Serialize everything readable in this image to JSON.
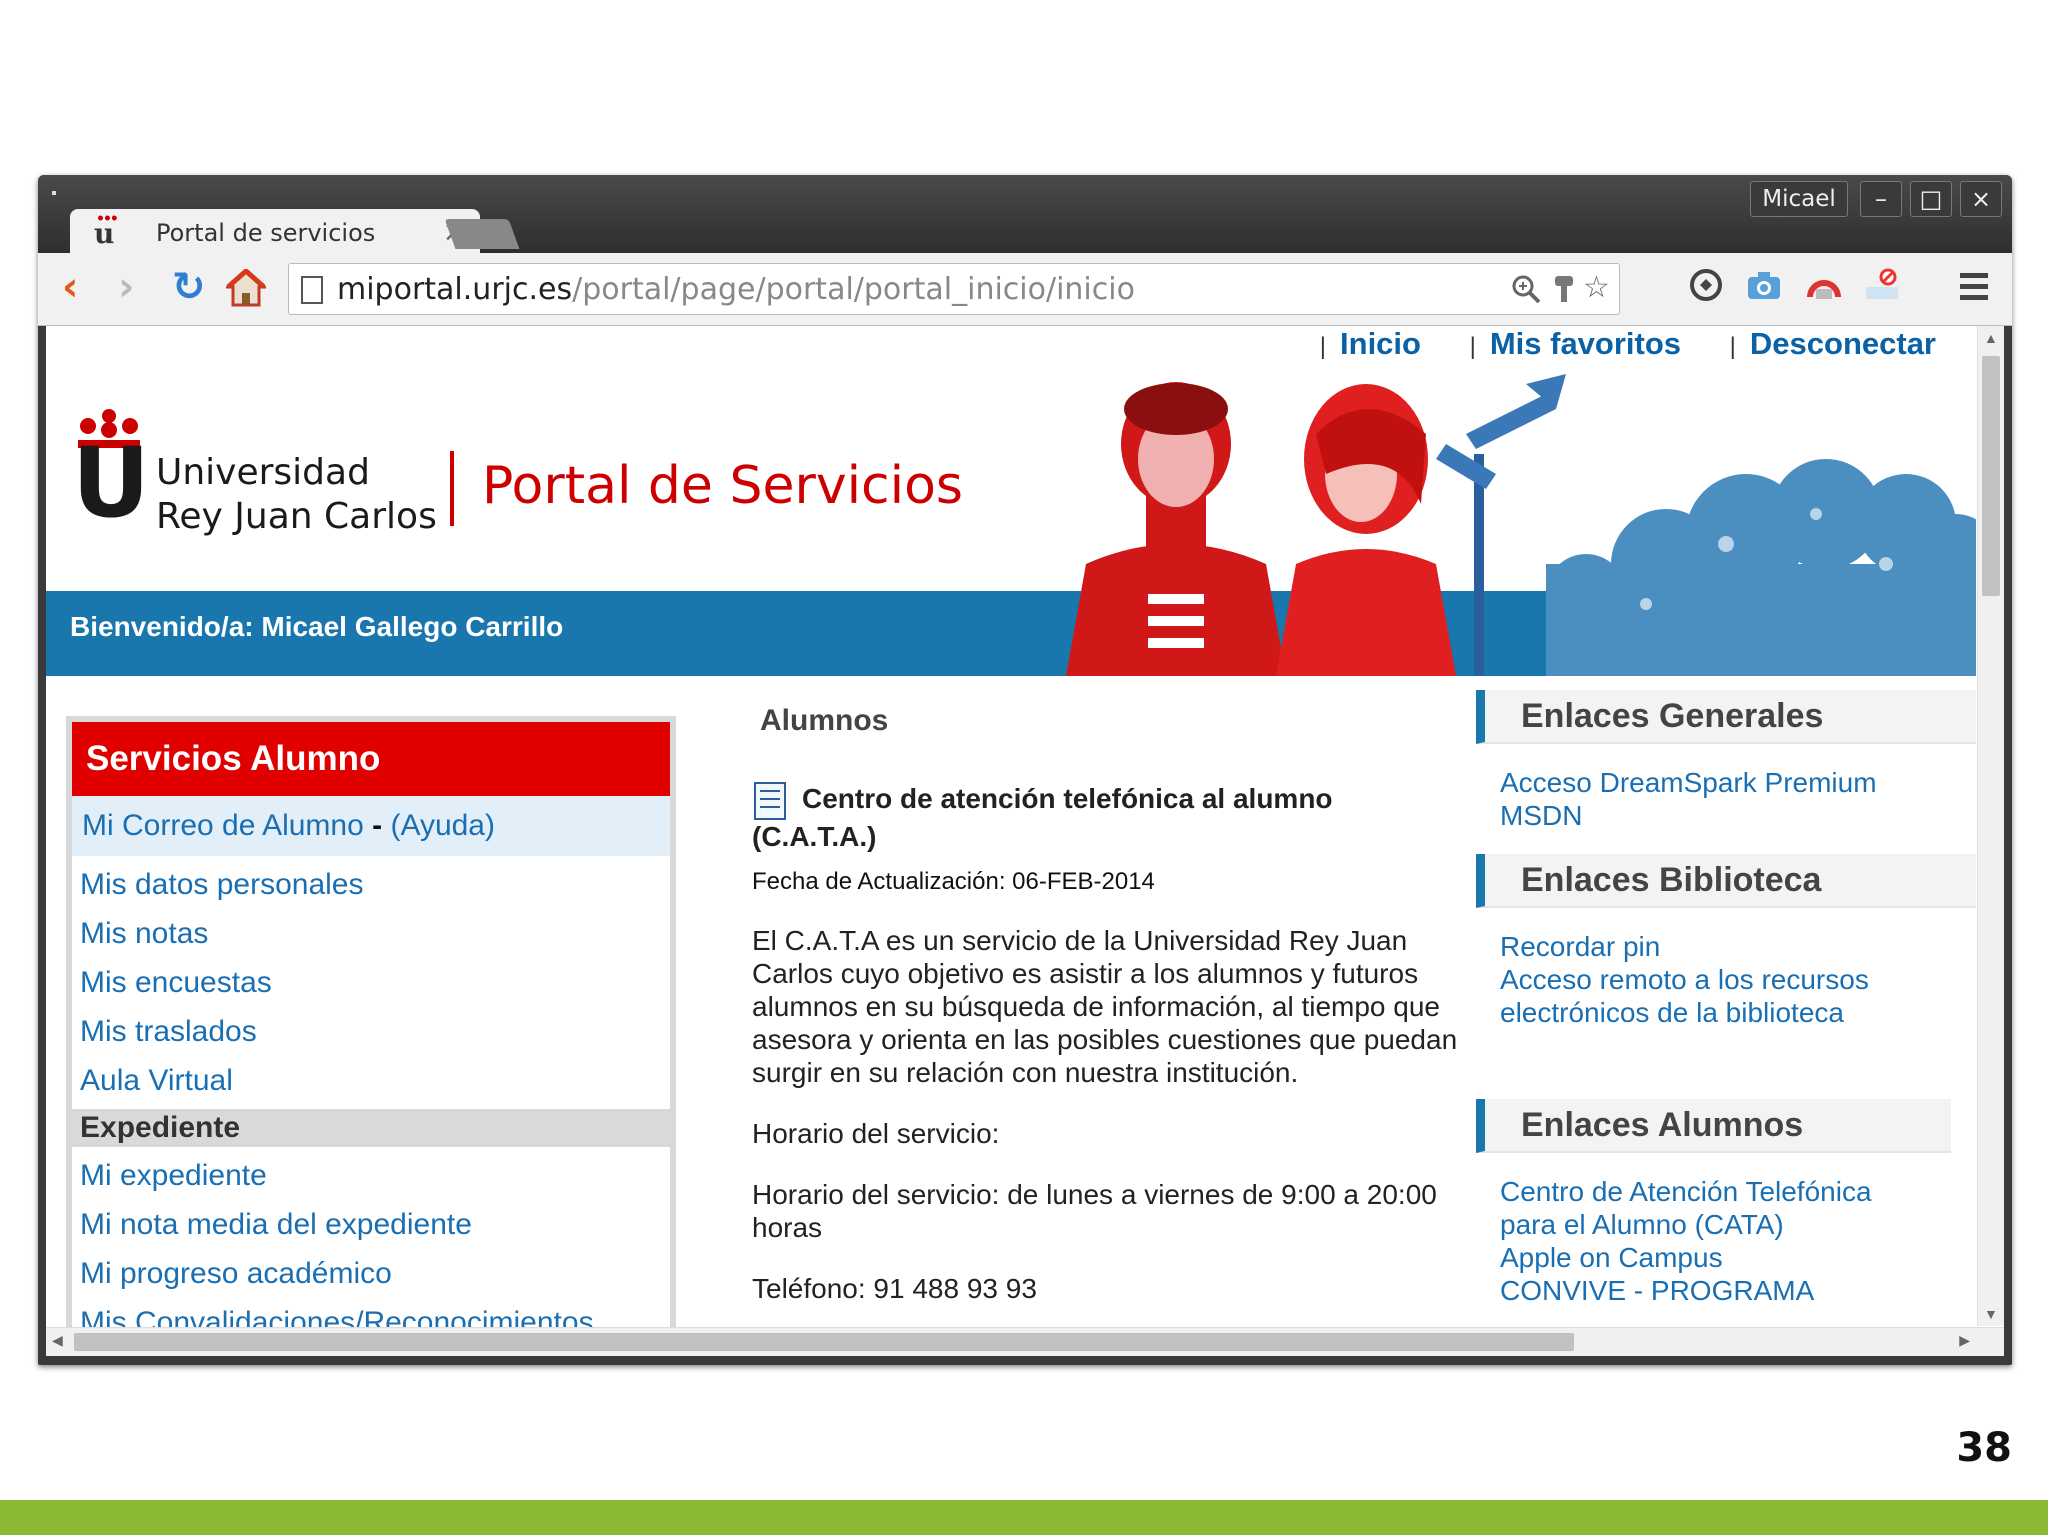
{
  "browser": {
    "tab_title": "Portal de servicios",
    "tab_close": "×",
    "user_name": "Micael",
    "window_buttons": {
      "minimize": "–",
      "maximize": "□",
      "close": "×"
    },
    "url_host": "miportal.urjc.es",
    "url_path": "/portal/page/portal/portal_inicio/inicio",
    "nav": {
      "back": "‹",
      "forward": "›",
      "reload": "↻"
    },
    "omnibox_icons": [
      "zoom-icon",
      "key-icon",
      "star-icon"
    ],
    "extension_icons": [
      "extension-1-icon",
      "camera-icon",
      "extension-3-icon",
      "extension-4-icon",
      "menu-icon"
    ]
  },
  "header": {
    "top_links": [
      {
        "sep": "|",
        "label": "Inicio"
      },
      {
        "sep": "|",
        "label": "Mis favoritos"
      },
      {
        "sep": "|",
        "label": "Desconectar"
      }
    ],
    "logo_line1": "Universidad",
    "logo_line2": "Rey Juan Carlos",
    "portal_title": "Portal de Servicios",
    "welcome": "Bienvenido/a: Micael Gallego Carrillo"
  },
  "left_menu": {
    "title": "Servicios Alumno",
    "mail_link": "Mi Correo de Alumno",
    "mail_dash": "-",
    "help_link": "(Ayuda)",
    "links": [
      "Mis datos personales",
      "Mis notas",
      "Mis encuestas",
      "Mis traslados",
      "Aula Virtual"
    ],
    "section_title": "Expediente",
    "section_links": [
      "Mi expediente",
      "Mi nota media del expediente",
      "Mi progreso académico",
      "Mis Convalidaciones/Reconocimientos"
    ]
  },
  "center": {
    "title": "Alumnos",
    "news_title": "Centro de atención telefónica al alumno",
    "news_title_cont": "(C.A.T.A.)",
    "date": "Fecha de Actualización: 06-FEB-2014",
    "p1": "El C.A.T.A es un servicio de la Universidad Rey Juan Carlos cuyo objetivo es asistir a los alumnos y futuros alumnos en su búsqueda de información, al tiempo que asesora y orienta en las posibles cuestiones que puedan surgir en su relación con nuestra institución.",
    "p2": "Horario del servicio:",
    "p3": "Horario del servicio: de lunes a viernes de 9:00 a 20:00 horas",
    "p4": "Teléfono: 91 488 93 93"
  },
  "right": {
    "generales_title": "Enlaces Generales",
    "generales_links": [
      "Acceso DreamSpark Premium MSDN"
    ],
    "biblioteca_title": "Enlaces Biblioteca",
    "biblioteca_links": [
      "Recordar pin",
      "Acceso remoto a los recursos electrónicos de la biblioteca"
    ],
    "alumnos_title": "Enlaces Alumnos",
    "alumnos_links": [
      "Centro de Atención Telefónica para el Alumno (CATA)",
      "Apple on Campus",
      "CONVIVE - PROGRAMA"
    ]
  },
  "slide": {
    "page_number": "38"
  },
  "colors": {
    "brand_red": "#e10000",
    "brand_blue": "#1a77ad",
    "link_blue": "#1a6fb3",
    "slide_band": "#8cb934"
  }
}
